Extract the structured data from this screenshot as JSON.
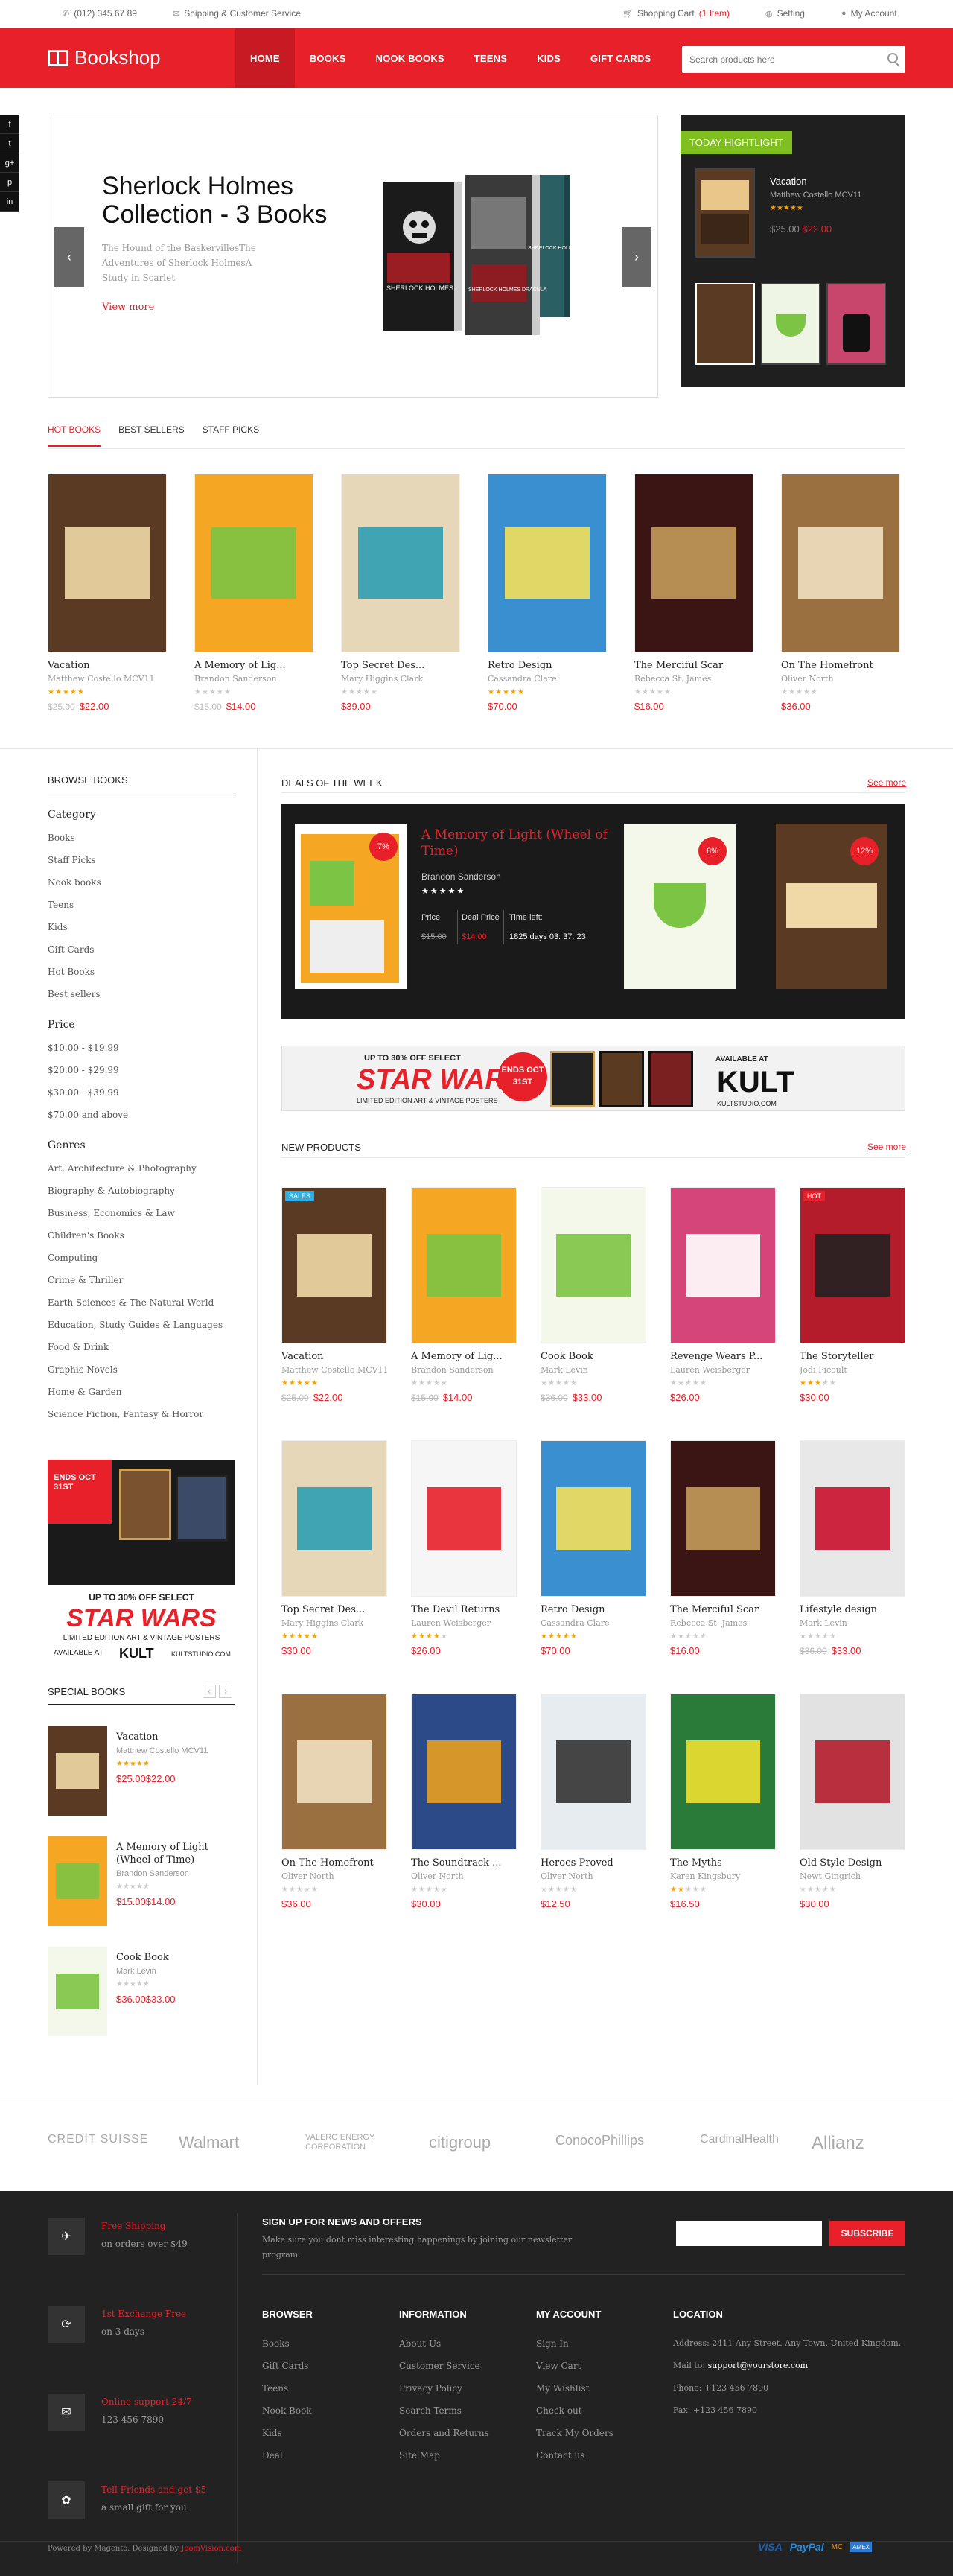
{
  "topbar": {
    "phone": "(012) 345 67 89",
    "service": "Shipping & Customer Service",
    "cart_label": "Shopping Cart",
    "cart_count": "(1 Item)",
    "setting": "Setting",
    "account": "My Account"
  },
  "header": {
    "logo": "Bookshop",
    "nav": [
      "HOME",
      "BOOKS",
      "NOOK BOOKS",
      "TEENS",
      "KIDS",
      "GIFT CARDS"
    ],
    "search_placeholder": "Search products here"
  },
  "social": [
    "f",
    "t",
    "g+",
    "p",
    "in"
  ],
  "slider": {
    "title": "Sherlock Holmes Collection - 3 Books",
    "desc": "The Hound of the BaskervillesThe Adventures of Sherlock HolmesA Study in Scarlet",
    "more": "View more",
    "books": [
      "SHERLOCK HOLMES",
      "SHERLOCK HOLMES DRACULA",
      "SHERLOCK HOLMES"
    ]
  },
  "highlight": {
    "tag": "TODAY HIGHTLIGHT",
    "title": "Vacation",
    "author": "Matthew Costello MCV11",
    "old": "$25.00",
    "price": "$22.00"
  },
  "tabs": [
    "HOT BOOKS",
    "BEST SELLERS",
    "STAFF PICKS"
  ],
  "hot": [
    {
      "title": "Vacation",
      "author": "Matthew Costello MCV11",
      "old": "$25.00",
      "price": "$22.00",
      "rating": 5
    },
    {
      "title": "A Memory of Lig...",
      "author": "Brandon Sanderson",
      "old": "$15.00",
      "price": "$14.00",
      "rating": 0
    },
    {
      "title": "Top Secret Des...",
      "author": "Mary Higgins Clark",
      "old": "",
      "price": "$39.00",
      "rating": 0
    },
    {
      "title": "Retro Design",
      "author": "Cassandra Clare",
      "old": "",
      "price": "$70.00",
      "rating": 5
    },
    {
      "title": "The Merciful Scar",
      "author": "Rebecca St. James",
      "old": "",
      "price": "$16.00",
      "rating": 0
    },
    {
      "title": "On The Homefront",
      "author": "Oliver North",
      "old": "",
      "price": "$36.00",
      "rating": 0
    }
  ],
  "sidebar": {
    "heading": "BROWSE BOOKS",
    "category_label": "Category",
    "categories": [
      "Books",
      "Staff Picks",
      "Nook books",
      "Teens",
      "Kids",
      "Gift Cards",
      "Hot Books",
      "Best sellers"
    ],
    "price_label": "Price",
    "prices": [
      "$10.00 - $19.99",
      "$20.00 - $29.99",
      "$30.00 - $39.99",
      "$70.00 and above"
    ],
    "genres_label": "Genres",
    "genres": [
      "Art, Architecture & Photography",
      "Biography & Autobiography",
      "Business, Economics & Law",
      "Children's Books",
      "Computing",
      "Crime & Thriller",
      "Earth Sciences & The Natural World",
      "Education, Study Guides & Languages",
      "Food & Drink",
      "Graphic Novels",
      "Home & Garden",
      "Science Fiction, Fantasy & Horror"
    ],
    "ad_top": "ENDS OCT 31ST",
    "ad_line1": "UP TO 30% OFF SELECT",
    "ad_star": "STAR WARS",
    "ad_line2": "LIMITED EDITION ART & VINTAGE POSTERS",
    "ad_avail": "AVAILABLE AT",
    "ad_kult": "KULT",
    "ad_url": "KULTSTUDIO.COM",
    "special_heading": "SPECIAL BOOKS",
    "special": [
      {
        "title": "Vacation",
        "author": "Matthew Costello MCV11",
        "old": "$25.00",
        "price": "$22.00",
        "rating": 5
      },
      {
        "title": "A Memory of Light (Wheel of Time)",
        "author": "Brandon Sanderson",
        "old": "$15.00",
        "price": "$14.00",
        "rating": 0
      },
      {
        "title": "Cook Book",
        "author": "Mark Levin",
        "old": "$36.00",
        "price": "$33.00",
        "rating": 0
      }
    ]
  },
  "deals": {
    "heading": "DEALS OF THE WEEK",
    "see_all": "See more",
    "title": "A Memory of Light (Wheel of Time)",
    "author": "Brandon Sanderson",
    "price_label": "Price",
    "deal_label": "Deal Price",
    "time_label": "Time left:",
    "price": "$15.00",
    "deal": "$14.00",
    "time": "1825 days 03: 37: 23",
    "pct": [
      "7%",
      "8%",
      "12%"
    ]
  },
  "banner": {
    "line1": "UP TO 30% OFF SELECT",
    "ends": "ENDS OCT 31ST",
    "star": "STAR WARS",
    "line2": "LIMITED EDITION ART & VINTAGE POSTERS",
    "avail": "AVAILABLE AT",
    "kult": "KULT",
    "url": "KULTSTUDIO.COM"
  },
  "newp": {
    "heading": "NEW PRODUCTS",
    "see_all": "See more",
    "items": [
      {
        "title": "Vacation",
        "author": "Matthew Costello MCV11",
        "old": "$25.00",
        "price": "$22.00",
        "rating": 5,
        "badge": "SALES"
      },
      {
        "title": "A Memory of Lig...",
        "author": "Brandon Sanderson",
        "old": "$15.00",
        "price": "$14.00",
        "rating": 0,
        "badge": ""
      },
      {
        "title": "Cook Book",
        "author": "Mark Levin",
        "old": "$36.00",
        "price": "$33.00",
        "rating": 0,
        "badge": ""
      },
      {
        "title": "Revenge Wears P...",
        "author": "Lauren Weisberger",
        "old": "",
        "price": "$26.00",
        "rating": 0,
        "badge": ""
      },
      {
        "title": "The Storyteller",
        "author": "Jodi Picoult",
        "old": "",
        "price": "$30.00",
        "rating": 3,
        "badge": "HOT"
      },
      {
        "title": "Top Secret Des...",
        "author": "Mary Higgins Clark",
        "old": "",
        "price": "$30.00",
        "rating": 5,
        "badge": ""
      },
      {
        "title": "The Devil Returns",
        "author": "Lauren Weisberger",
        "old": "",
        "price": "$26.00",
        "rating": 4,
        "badge": ""
      },
      {
        "title": "Retro Design",
        "author": "Cassandra Clare",
        "old": "",
        "price": "$70.00",
        "rating": 5,
        "badge": ""
      },
      {
        "title": "The Merciful Scar",
        "author": "Rebecca St. James",
        "old": "",
        "price": "$16.00",
        "rating": 0,
        "badge": ""
      },
      {
        "title": "Lifestyle design",
        "author": "Mark Levin",
        "old": "$36.00",
        "price": "$33.00",
        "rating": 0,
        "badge": ""
      },
      {
        "title": "On The Homefront",
        "author": "Oliver North",
        "old": "",
        "price": "$36.00",
        "rating": 0,
        "badge": ""
      },
      {
        "title": "The Soundtrack ...",
        "author": "Oliver North",
        "old": "",
        "price": "$30.00",
        "rating": 0,
        "badge": ""
      },
      {
        "title": "Heroes Proved",
        "author": "Oliver North",
        "old": "",
        "price": "$12.50",
        "rating": 0,
        "badge": ""
      },
      {
        "title": "The Myths",
        "author": "Karen Kingsbury",
        "old": "",
        "price": "$16.50",
        "rating": 2,
        "badge": ""
      },
      {
        "title": "Old Style Design",
        "author": "Newt Gingrich",
        "old": "",
        "price": "$30.00",
        "rating": 0,
        "badge": ""
      }
    ]
  },
  "brands": [
    "CREDIT SUISSE",
    "Walmart",
    "VALERO ENERGY CORPORATION",
    "citigroup",
    "ConocoPhillips",
    "CardinalHealth",
    "Allianz"
  ],
  "footer": {
    "features": [
      {
        "title": "Free Shipping",
        "sub": "on orders over $49",
        "icon": "plane-icon"
      },
      {
        "title": "1st Exchange Free",
        "sub": "on 3 days",
        "icon": "refresh-icon"
      },
      {
        "title": "Online support 24/7",
        "sub": "123 456 7890",
        "icon": "chat-icon"
      },
      {
        "title": "Tell Friends and get $5",
        "sub": "a small gift for you",
        "icon": "gift-icon"
      }
    ],
    "newsletter_title": "SIGN UP FOR NEWS AND OFFERS",
    "newsletter_text": "Make sure you dont miss interesting happenings by joining our newsletter program.",
    "subscribe": "SUBSCRIBE",
    "cols": [
      {
        "title": "BROWSER",
        "links": [
          "Books",
          "Gift Cards",
          "Teens",
          "Nook Book",
          "Kids",
          "Deal"
        ]
      },
      {
        "title": "INFORMATION",
        "links": [
          "About Us",
          "Customer Service",
          "Privacy Policy",
          "Search Terms",
          "Orders and Returns",
          "Site Map"
        ]
      },
      {
        "title": "MY ACCOUNT",
        "links": [
          "Sign In",
          "View Cart",
          "My Wishlist",
          "Check out",
          "Track My Orders",
          "Contact us"
        ]
      }
    ],
    "location_title": "LOCATION",
    "address": "Address: 2411 Any Street. Any Town. United Kingdom.",
    "mail_label": "Mail to:",
    "mail": "support@yourstore.com",
    "phone": "Phone: +123 456 7890",
    "fax": "Fax: +123 456 7890",
    "powered": "Powered by Magento. Designed by",
    "designer": "JoomVision.com",
    "payments": [
      "VISA",
      "PayPal",
      "MC",
      "AMEX"
    ]
  },
  "colors": {
    "brand": "#e8202a",
    "dark": "#1f1f1f",
    "green": "#7fbf1f"
  }
}
